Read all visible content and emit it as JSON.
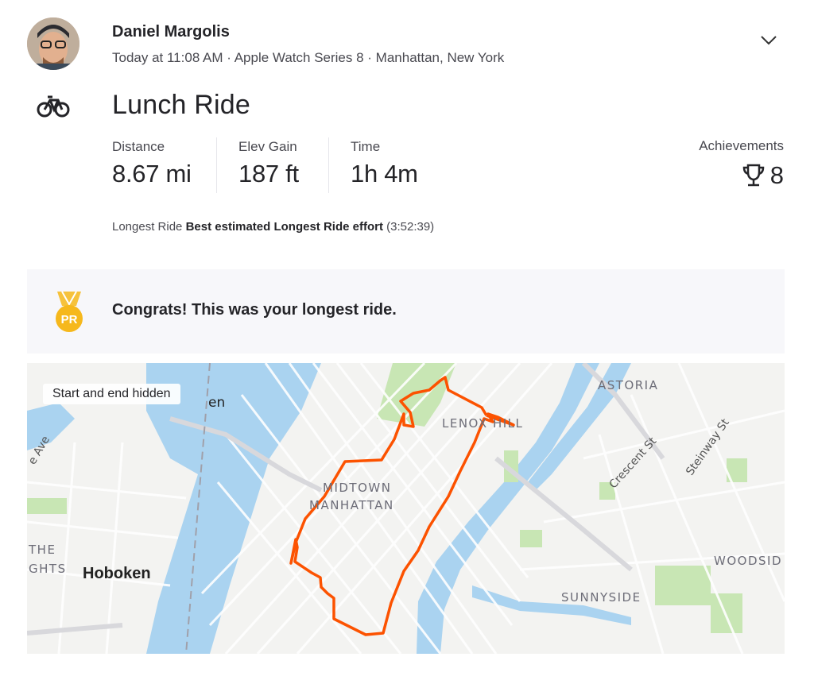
{
  "athlete": {
    "name": "Daniel Margolis",
    "meta": "Today at 11:08 AM · Apple Watch Series 8 · Manhattan, New York"
  },
  "activity": {
    "sport_icon": "bike-icon",
    "title": "Lunch Ride"
  },
  "stats": [
    {
      "label": "Distance",
      "value": "8.67 mi"
    },
    {
      "label": "Elev Gain",
      "value": "187 ft"
    },
    {
      "label": "Time",
      "value": "1h 4m"
    }
  ],
  "achievements": {
    "label": "Achievements",
    "icon": "trophy-icon",
    "count": "8"
  },
  "effort": {
    "prefix": "Longest Ride",
    "highlight": "Best estimated Longest Ride effort",
    "time": "(3:52:39)"
  },
  "banner": {
    "icon": "pr-medal-icon",
    "icon_text": "PR",
    "text": "Congrats! This was your longest ride."
  },
  "map": {
    "chip": "Start and end hidden",
    "labels": {
      "astoria": "ASTORIA",
      "lenox": "LENOX HILL",
      "midtown": "MIDTOWN",
      "manhattan": "MANHATTAN",
      "crescent": "Crescent St",
      "steinway": "Steinway St",
      "woodside": "WOODSID",
      "sunnyside": "SUNNYSIDE",
      "hoboken": "Hoboken",
      "the": "THE",
      "ghts": "GHTS",
      "ave": "e Ave",
      "en": "en"
    },
    "route_color": "#fc5200",
    "water_color": "#aad3f0",
    "park_color": "#c8e6b4"
  }
}
